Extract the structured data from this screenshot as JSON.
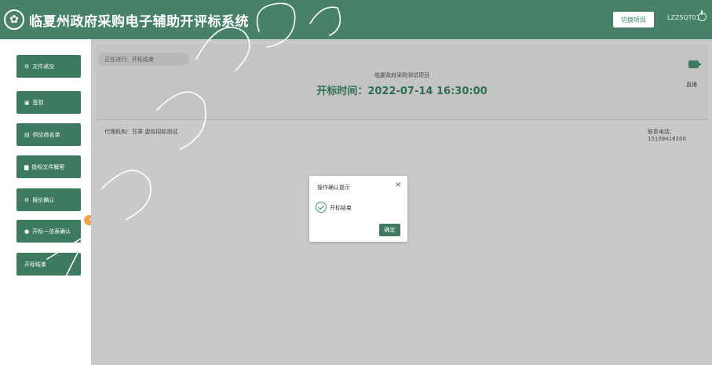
{
  "header": {
    "title": "临夏州政府采购电子辅助开评标系统",
    "switch_label": "切换项目",
    "user_id": "LZZSQT01"
  },
  "sidebar": {
    "items": [
      {
        "label": "文件递交",
        "icon": "gear-icon"
      },
      {
        "label": "签到",
        "icon": "check-square-icon"
      },
      {
        "label": "供应商名单",
        "icon": "list-icon"
      },
      {
        "label": "投标文件解密",
        "icon": "folder-icon"
      },
      {
        "label": "报价确认",
        "icon": "gear-icon"
      },
      {
        "label": "开标一览表确认",
        "icon": "dot-icon"
      },
      {
        "label": "开标结束",
        "icon": ""
      }
    ]
  },
  "main": {
    "progress": "正在进行：开标结束",
    "project_name": "临夏政府采购测试项目",
    "open_time_label": "开标时间：2022-07-14 16:30:00",
    "live_label": "直播",
    "agency": "代理机构：甘肃 虚拟招标测试",
    "phone": "联系电话：15109418200"
  },
  "dialog": {
    "title": "操作确认提示",
    "close": "×",
    "message": "开标结束",
    "ok_label": "确定"
  },
  "colors": {
    "brand": "#47816a",
    "button": "#3d7a5f",
    "badge": "#f0a347"
  }
}
